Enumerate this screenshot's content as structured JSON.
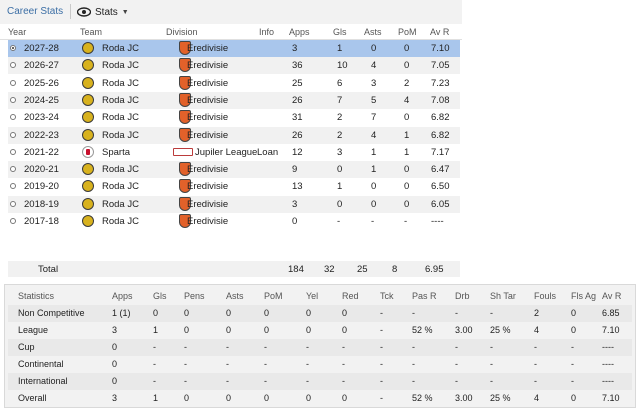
{
  "toolbar": {
    "career_tab": "Career Stats",
    "stats_dropdown": "Stats"
  },
  "career": {
    "headers": [
      "Year",
      "Team",
      "Division",
      "Info",
      "Apps",
      "Gls",
      "Asts",
      "PoM",
      "Av R"
    ],
    "rows": [
      {
        "year": "2027-28",
        "team": "Roda JC",
        "division": "Eredivisie",
        "info": "",
        "apps": "3",
        "gls": "1",
        "asts": "0",
        "pom": "0",
        "avr": "7.10",
        "selected": true
      },
      {
        "year": "2026-27",
        "team": "Roda JC",
        "division": "Eredivisie",
        "info": "",
        "apps": "36",
        "gls": "10",
        "asts": "4",
        "pom": "0",
        "avr": "7.05"
      },
      {
        "year": "2025-26",
        "team": "Roda JC",
        "division": "Eredivisie",
        "info": "",
        "apps": "25",
        "gls": "6",
        "asts": "3",
        "pom": "2",
        "avr": "7.23"
      },
      {
        "year": "2024-25",
        "team": "Roda JC",
        "division": "Eredivisie",
        "info": "",
        "apps": "26",
        "gls": "7",
        "asts": "5",
        "pom": "4",
        "avr": "7.08"
      },
      {
        "year": "2023-24",
        "team": "Roda JC",
        "division": "Eredivisie",
        "info": "",
        "apps": "31",
        "gls": "2",
        "asts": "7",
        "pom": "0",
        "avr": "6.82"
      },
      {
        "year": "2022-23",
        "team": "Roda JC",
        "division": "Eredivisie",
        "info": "",
        "apps": "26",
        "gls": "2",
        "asts": "4",
        "pom": "1",
        "avr": "6.82"
      },
      {
        "year": "2021-22",
        "team": "Sparta",
        "division": "Jupiler League",
        "info": "Loan",
        "apps": "12",
        "gls": "3",
        "asts": "1",
        "pom": "1",
        "avr": "7.17"
      },
      {
        "year": "2020-21",
        "team": "Roda JC",
        "division": "Eredivisie",
        "info": "",
        "apps": "9",
        "gls": "0",
        "asts": "1",
        "pom": "0",
        "avr": "6.47"
      },
      {
        "year": "2019-20",
        "team": "Roda JC",
        "division": "Eredivisie",
        "info": "",
        "apps": "13",
        "gls": "1",
        "asts": "0",
        "pom": "0",
        "avr": "6.50"
      },
      {
        "year": "2018-19",
        "team": "Roda JC",
        "division": "Eredivisie",
        "info": "",
        "apps": "3",
        "gls": "0",
        "asts": "0",
        "pom": "0",
        "avr": "6.05"
      },
      {
        "year": "2017-18",
        "team": "Roda JC",
        "division": "Eredivisie",
        "info": "",
        "apps": "0",
        "gls": "-",
        "asts": "-",
        "pom": "-",
        "avr": "----"
      }
    ],
    "total": {
      "label": "Total",
      "apps": "184",
      "gls": "32",
      "asts": "25",
      "pom": "8",
      "avr": "6.95"
    }
  },
  "statistics": {
    "headers": [
      "Statistics",
      "Apps",
      "Gls",
      "Pens",
      "Asts",
      "PoM",
      "Yel",
      "Red",
      "Tck",
      "Pas R",
      "Drb",
      "Sh Tar",
      "Fouls",
      "Fls Ag",
      "Av R"
    ],
    "rows": [
      [
        "Non Competitive",
        "1 (1)",
        "0",
        "0",
        "0",
        "0",
        "0",
        "0",
        "-",
        "-",
        "-",
        "-",
        "2",
        "0",
        "6.85"
      ],
      [
        "League",
        "3",
        "1",
        "0",
        "0",
        "0",
        "0",
        "0",
        "-",
        "52 %",
        "3.00",
        "25 %",
        "4",
        "0",
        "7.10"
      ],
      [
        "Cup",
        "0",
        "-",
        "-",
        "-",
        "-",
        "-",
        "-",
        "-",
        "-",
        "-",
        "-",
        "-",
        "-",
        "----"
      ],
      [
        "Continental",
        "0",
        "-",
        "-",
        "-",
        "-",
        "-",
        "-",
        "-",
        "-",
        "-",
        "-",
        "-",
        "-",
        "----"
      ],
      [
        "International",
        "0",
        "-",
        "-",
        "-",
        "-",
        "-",
        "-",
        "-",
        "-",
        "-",
        "-",
        "-",
        "-",
        "----"
      ],
      [
        "Overall",
        "3",
        "1",
        "0",
        "0",
        "0",
        "0",
        "0",
        "-",
        "52 %",
        "3.00",
        "25 %",
        "4",
        "0",
        "7.10"
      ]
    ]
  }
}
